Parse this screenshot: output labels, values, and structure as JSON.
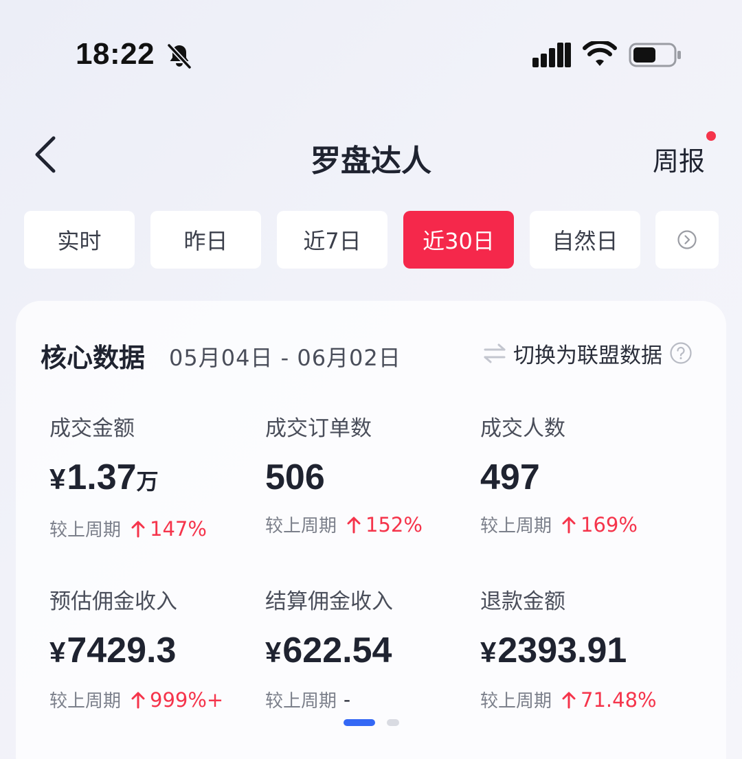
{
  "status_bar": {
    "time": "18:22"
  },
  "nav": {
    "title": "罗盘达人",
    "right_label": "周报"
  },
  "tabs": [
    {
      "label": "实时",
      "active": false
    },
    {
      "label": "昨日",
      "active": false
    },
    {
      "label": "近7日",
      "active": false
    },
    {
      "label": "近30日",
      "active": true
    },
    {
      "label": "自然日",
      "active": false
    }
  ],
  "card": {
    "title": "核心数据",
    "date_range": "05月04日 - 06月02日",
    "switch_label": "切换为联盟数据"
  },
  "compare_label": "较上周期",
  "metrics": [
    {
      "label": "成交金额",
      "currency": "¥",
      "value": "1.37",
      "unit": "万",
      "change": "147%"
    },
    {
      "label": "成交订单数",
      "currency": "",
      "value": "506",
      "unit": "",
      "change": "152%"
    },
    {
      "label": "成交人数",
      "currency": "",
      "value": "497",
      "unit": "",
      "change": "169%"
    },
    {
      "label": "预估佣金收入",
      "currency": "¥",
      "value": "7429.3",
      "unit": "",
      "change": "999%+"
    },
    {
      "label": "结算佣金收入",
      "currency": "¥",
      "value": "622.54",
      "unit": "",
      "change": "-"
    },
    {
      "label": "退款金额",
      "currency": "¥",
      "value": "2393.91",
      "unit": "",
      "change": "71.48%"
    }
  ],
  "colors": {
    "accent": "#f5284b",
    "increase": "#f5344b",
    "pager_active": "#3468f5"
  },
  "icons": [
    "bell-off-icon",
    "signal-icon",
    "wifi-icon",
    "battery-icon",
    "back-icon",
    "chevron-right-circle-icon",
    "swap-icon",
    "help-icon",
    "arrow-up-icon"
  ],
  "pager": {
    "total": 2,
    "current": 1
  }
}
